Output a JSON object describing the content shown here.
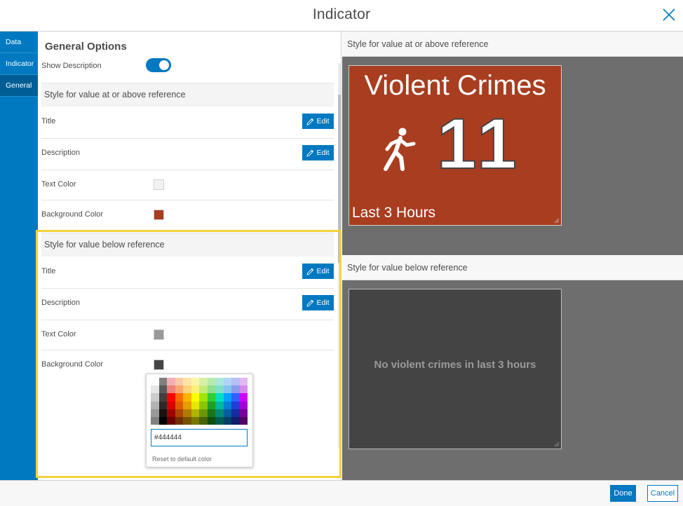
{
  "dialog": {
    "title": "Indicator",
    "close_icon": "close-icon"
  },
  "sidenav": {
    "items": [
      {
        "label": "Data",
        "active": false
      },
      {
        "label": "Indicator",
        "active": false
      },
      {
        "label": "General",
        "active": true
      }
    ]
  },
  "settings": {
    "heading": "General Options",
    "show_description_label": "Show Description",
    "show_description_on": true,
    "above": {
      "heading": "Style for value at or above reference",
      "title_label": "Title",
      "description_label": "Description",
      "text_color_label": "Text Color",
      "text_color": "#f2f2f2",
      "background_color_label": "Background Color",
      "background_color": "#a83d20"
    },
    "below": {
      "heading": "Style for value below reference",
      "title_label": "Title",
      "description_label": "Description",
      "text_color_label": "Text Color",
      "text_color": "#999999",
      "background_color_label": "Background Color",
      "background_color": "#444444"
    },
    "edit_label": "Edit",
    "edit_icon": "pencil-icon"
  },
  "color_picker": {
    "hex_value": "#444444",
    "reset_label": "Reset to default color",
    "palette": [
      [
        "#ffffff",
        "#7f7f7f",
        "#f2b0b4",
        "#f9c9a9",
        "#fde3a6",
        "#fef6a6",
        "#d8f0a6",
        "#b8eab0",
        "#aae8d8",
        "#aed6f5",
        "#b6c0f2",
        "#e2b6f2"
      ],
      [
        "#e6e6e6",
        "#595959",
        "#f08080",
        "#f7a870",
        "#fcd27a",
        "#fdf07a",
        "#c4ea7a",
        "#8fe08e",
        "#7fdfc8",
        "#84c4f1",
        "#8c9cec",
        "#d48aec"
      ],
      [
        "#cccccc",
        "#404040",
        "#ff0000",
        "#ff6a00",
        "#ffb300",
        "#ffff00",
        "#a6e300",
        "#33cc33",
        "#00e0c0",
        "#00a3ff",
        "#2f5fff",
        "#cc00ff"
      ],
      [
        "#b3b3b3",
        "#2a2a2a",
        "#d90000",
        "#e05a00",
        "#e69e00",
        "#e6e600",
        "#8cc400",
        "#229e22",
        "#00b89c",
        "#0080d4",
        "#1f3fd4",
        "#a300d4"
      ],
      [
        "#999999",
        "#141414",
        "#a30000",
        "#ad4500",
        "#b37a00",
        "#b3b300",
        "#6b9600",
        "#177517",
        "#008a75",
        "#005f9e",
        "#152d9e",
        "#7a009e"
      ],
      [
        "#808080",
        "#000000",
        "#6e0000",
        "#732e00",
        "#785200",
        "#787800",
        "#476400",
        "#0e4f0e",
        "#005c4e",
        "#004069",
        "#0e1e69",
        "#520069"
      ]
    ]
  },
  "preview": {
    "above_heading": "Style for value at or above reference",
    "above_card": {
      "title": "Violent Crimes",
      "value": "11",
      "description": "Last 3 Hours",
      "icon": "running-person-icon",
      "background": "#a83d20"
    },
    "below_heading": "Style for value below reference",
    "below_card": {
      "message": "No violent crimes in last 3 hours",
      "background": "#444444"
    }
  },
  "footer": {
    "done_label": "Done",
    "cancel_label": "Cancel"
  }
}
